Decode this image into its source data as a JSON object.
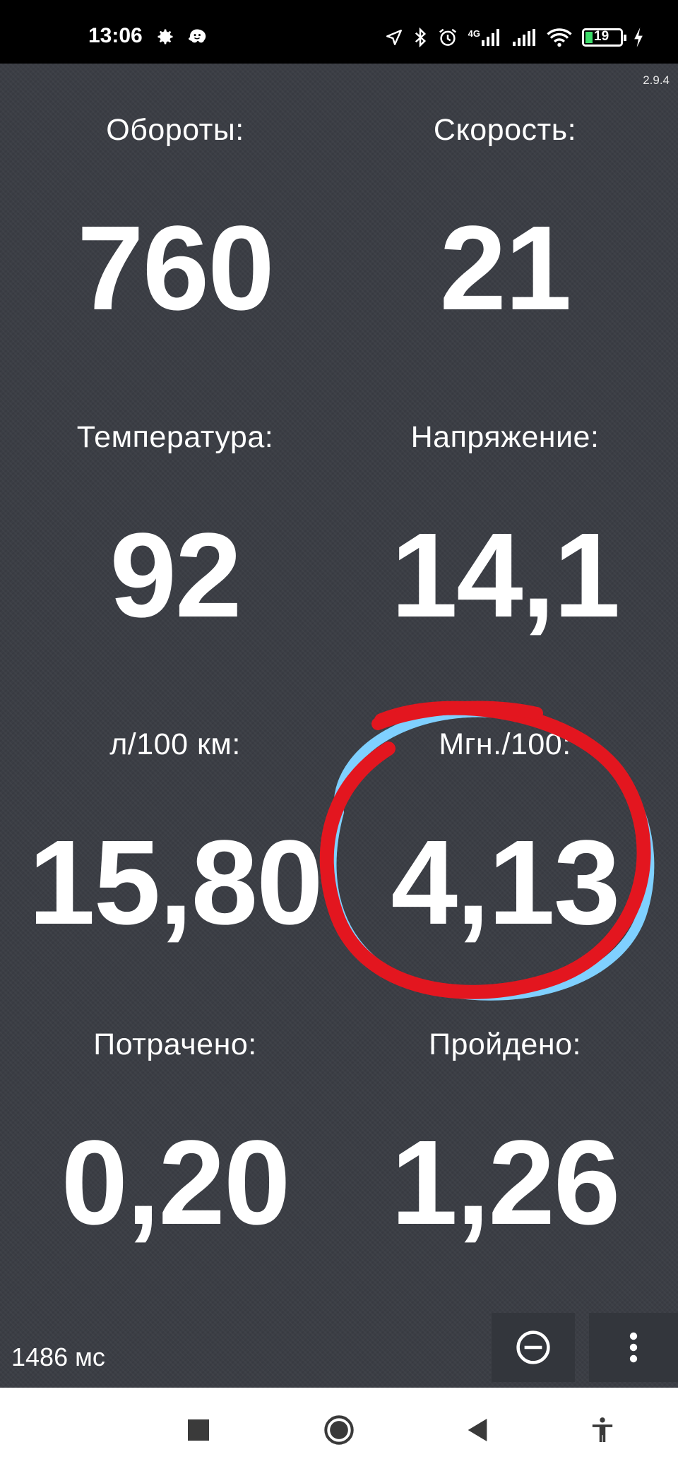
{
  "status_bar": {
    "time": "13:06",
    "network_label": "4G",
    "battery_percent": "19"
  },
  "app": {
    "version": "2.9.4",
    "metrics": [
      {
        "label": "Обороты:",
        "value": "760"
      },
      {
        "label": "Скорость:",
        "value": "21"
      },
      {
        "label": "Температура:",
        "value": "92"
      },
      {
        "label": "Напряжение:",
        "value": "14,1"
      },
      {
        "label": "л/100 км:",
        "value": "15,80"
      },
      {
        "label": "Мгн./100:",
        "value": "4,13"
      },
      {
        "label": "Потрачено:",
        "value": "0,20"
      },
      {
        "label": "Пройдено:",
        "value": "1,26"
      }
    ],
    "latency": "1486 мс"
  },
  "colors": {
    "background": "#3b3e45",
    "text": "#ffffff",
    "annotation_red": "#e3161f",
    "annotation_blue": "#7fd0ff",
    "battery_green": "#3ddc6a"
  },
  "icons": [
    "gear-icon",
    "waze-icon",
    "location-icon",
    "bluetooth-icon",
    "alarm-icon",
    "signal-icon",
    "wifi-icon",
    "battery-icon",
    "charging-icon",
    "zoom-out-icon",
    "more-vert-icon",
    "recents-icon",
    "home-icon",
    "back-icon",
    "accessibility-icon"
  ]
}
